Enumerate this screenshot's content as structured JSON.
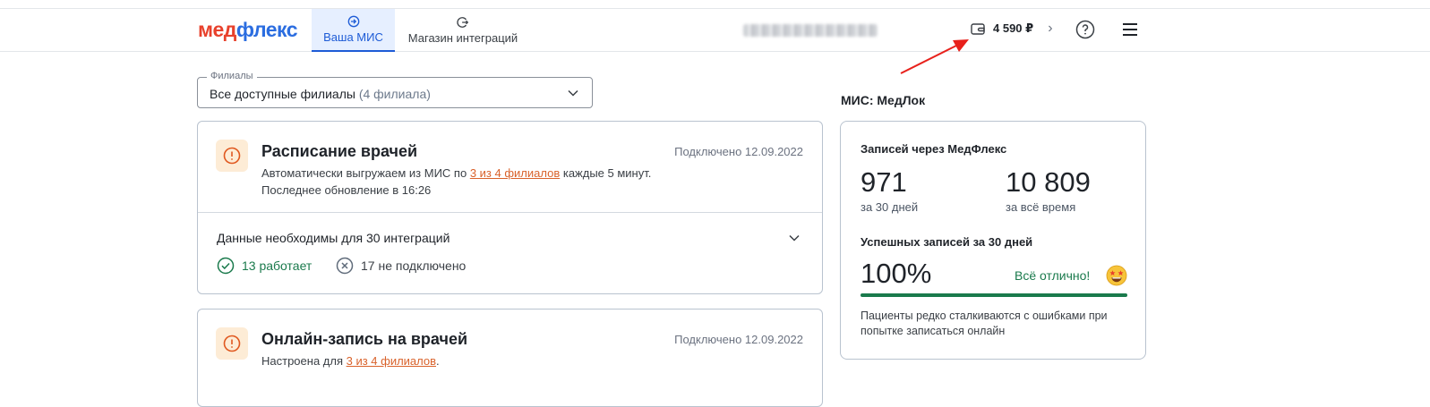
{
  "header": {
    "logo_part1": "мед",
    "logo_part2": "флекс",
    "tabs": [
      {
        "label": "Ваша МИС",
        "icon": "login-icon",
        "active": true
      },
      {
        "label": "Магазин интеграций",
        "icon": "logout-icon",
        "active": false
      }
    ],
    "balance": "4 590 ₽"
  },
  "branches": {
    "legend": "Филиалы",
    "value": "Все доступные филиалы",
    "count": "(4 филиала)"
  },
  "cards": [
    {
      "title": "Расписание врачей",
      "connected": "Подключено 12.09.2022",
      "desc_prefix": "Автоматически выгружаем из МИС по ",
      "desc_link": "3 из 4 филиалов",
      "desc_suffix": " каждые 5 минут.",
      "desc_line2": "Последнее обновление в 16:26",
      "needs": "Данные необходимы для 30 интеграций",
      "working": "13 работает",
      "not_connected": "17 не подключено"
    },
    {
      "title": "Онлайн-запись на врачей",
      "connected": "Подключено 12.09.2022",
      "desc_prefix": "Настроена для ",
      "desc_link": "3 из 4 филиалов",
      "desc_suffix": "."
    }
  ],
  "side": {
    "mis_title": "МИС: МедЛок",
    "records_title": "Записей через МедФлекс",
    "records_30": "971",
    "records_30_label": "за 30 дней",
    "records_all": "10 809",
    "records_all_label": "за всё время",
    "success_title": "Успешных записей за 30 дней",
    "success_pct": "100%",
    "success_fraction": 1.0,
    "status": "Всё отлично!",
    "note": "Пациенты редко сталкиваются с ошибками при попытке записаться онлайн"
  },
  "colors": {
    "accent": "#1d5bd6",
    "logo_red": "#e8412c",
    "logo_blue": "#2b6de0",
    "success": "#1a7a4c",
    "warning_bg": "#fdecd6",
    "warning": "#e0581f",
    "link": "#d9622b",
    "annotation_arrow": "#e8201b"
  }
}
